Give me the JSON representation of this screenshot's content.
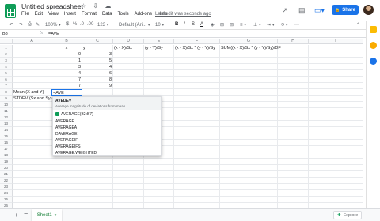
{
  "doc": {
    "title": "Untitled spreadsheet",
    "title_icons": "☆ ⇩ ☁",
    "last_edit": "Last edit was seconds ago",
    "share": "Share",
    "share_icon": "🔒",
    "comment_icon": "▤",
    "trend_icon": "↗",
    "present_icon": "▭▾"
  },
  "menu": [
    "File",
    "Edit",
    "View",
    "Insert",
    "Format",
    "Data",
    "Tools",
    "Add-ons",
    "Help"
  ],
  "toolbar": {
    "undo": "↶",
    "redo": "↷",
    "print": "⎙",
    "paint": "✎",
    "zoom": "100% ▾",
    "currency": "$",
    "percent": "%",
    "dec_less": ".0",
    "dec_more": ".00",
    "format": "123 ▾",
    "font": "Default (Ari... ▾",
    "font_size": "10 ▾",
    "bold": "B",
    "italic": "I",
    "strike": "S",
    "text_color": "A",
    "fill": "◈",
    "borders": "⊞",
    "merge": "⊟",
    "align": "≡ ▾",
    "valign": "⊥ ▾",
    "wrap": "⇥ ▾",
    "rotate": "⟲ ▾",
    "more": "⋯",
    "collapse": "⌃"
  },
  "formula_bar": {
    "cell_ref": "B8",
    "fx": "fx",
    "value": "=AVE"
  },
  "columns": [
    "A",
    "B",
    "C",
    "D",
    "E",
    "F",
    "G",
    "H",
    "I"
  ],
  "rows": [
    "1",
    "2",
    "3",
    "4",
    "5",
    "6",
    "7",
    "8",
    "9",
    "10",
    "11",
    "12",
    "13",
    "14",
    "15",
    "16",
    "17",
    "18",
    "19",
    "20",
    "21",
    "22",
    "23",
    "24",
    "25",
    "26"
  ],
  "cells": {
    "b1": "x",
    "c1": "y",
    "d1": "(x - X)/Sx",
    "e1": "(y - Y)/Sy",
    "f1": "(x - X)/Sx * (y - Y)/Sy",
    "g1": "SUM((x - X)/Sx * (y - Y)/Sy)/DF",
    "b2": "0",
    "c2": "3",
    "b3": "1",
    "c3": "5",
    "b4": "3",
    "c4": "4",
    "b5": "4",
    "c5": "6",
    "b6": "7",
    "c6": "8",
    "b7": "7",
    "c7": "9",
    "a8": "Mean (X and Y)",
    "b8": "=AVE",
    "a9": "STDEV (Sx and Sy)"
  },
  "autocomplete": {
    "top_name": "AVEDEV",
    "top_desc": "Average magnitude of deviations from mean.",
    "suggestion": "AVERAGE(B2:B7)",
    "items": [
      "AVERAGE",
      "AVERAGEA",
      "DAVERAGE",
      "AVERAGEIF",
      "AVERAGEIFS",
      "AVERAGE.WEIGHTED"
    ]
  },
  "sheet_tabs": {
    "add": "+",
    "list": "☰",
    "active": "Sheet1",
    "caret": "▾"
  },
  "explore": {
    "icon": "✚",
    "label": "Explore"
  },
  "colors": {
    "accent": "#1a73e8",
    "brand": "#0f9d58"
  }
}
